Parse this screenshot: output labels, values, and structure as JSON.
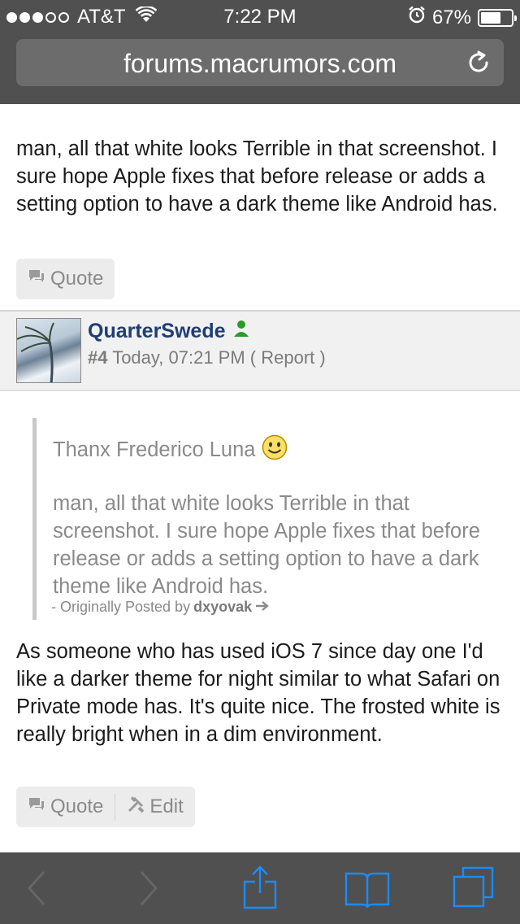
{
  "status_bar": {
    "carrier": "AT&T",
    "time": "7:22 PM",
    "battery_percent": "67%",
    "signal_bars_filled": 3,
    "signal_bars_total": 5,
    "battery_level": 0.67
  },
  "browser": {
    "url": "forums.macrumors.com"
  },
  "post_previous": {
    "text": "man, all that white looks Terrible in that screenshot. I sure hope Apple fixes that before release or adds a setting option to have a dark theme like Android has.",
    "quote_label": "Quote"
  },
  "post": {
    "username": "QuarterSwede",
    "number": "#4",
    "timestamp": " Today, 07:21 PM",
    "report_label": "( Report )",
    "quote_block": {
      "greeting": "Thanx Frederico Luna",
      "body": "man, all that white looks Terrible in that screenshot. I sure hope Apple fixes that before release or adds a setting option to have a dark theme like Android has.",
      "attribution_prefix": "- Originally Posted by",
      "attribution_user": "dxyovak"
    },
    "text": "As someone who has used iOS 7 since day one I'd like a darker theme for night similar to what Safari on Private mode has. It's quite nice. The frosted white is really bright when in a dim environment.",
    "quote_label": "Quote",
    "edit_label": "Edit"
  },
  "colors": {
    "chrome": "#505050",
    "link": "#1f3e73",
    "toolbar_icon": "#1a8cff",
    "online_icon": "#2a9a2a"
  }
}
